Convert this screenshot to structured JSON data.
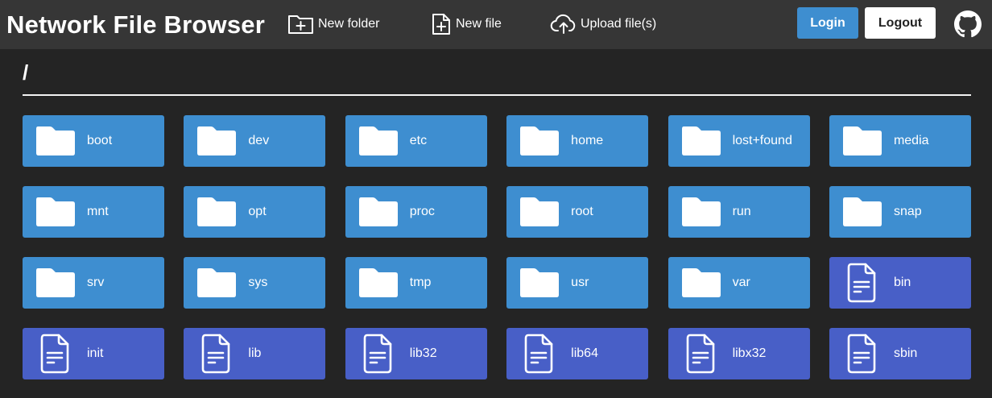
{
  "app": {
    "title": "Network File Browser"
  },
  "toolbar": {
    "new_folder_label": "New folder",
    "new_file_label": "New file",
    "upload_label": "Upload file(s)",
    "login_label": "Login",
    "logout_label": "Logout",
    "github_icon": "github-icon"
  },
  "colors": {
    "navbar": "#363636",
    "background": "#242424",
    "folder_tile": "#3e8ed0",
    "file_tile": "#485fc7",
    "login_button": "#3e8ed0",
    "logout_button": "#ffffff"
  },
  "location": {
    "path": "/"
  },
  "entries": [
    {
      "name": "boot",
      "type": "folder",
      "icon": "folder-icon"
    },
    {
      "name": "dev",
      "type": "folder",
      "icon": "folder-icon"
    },
    {
      "name": "etc",
      "type": "folder",
      "icon": "folder-icon"
    },
    {
      "name": "home",
      "type": "folder",
      "icon": "folder-icon"
    },
    {
      "name": "lost+found",
      "type": "folder",
      "icon": "folder-icon"
    },
    {
      "name": "media",
      "type": "folder",
      "icon": "folder-icon"
    },
    {
      "name": "mnt",
      "type": "folder",
      "icon": "folder-icon"
    },
    {
      "name": "opt",
      "type": "folder",
      "icon": "folder-icon"
    },
    {
      "name": "proc",
      "type": "folder",
      "icon": "folder-icon"
    },
    {
      "name": "root",
      "type": "folder",
      "icon": "folder-icon"
    },
    {
      "name": "run",
      "type": "folder",
      "icon": "folder-icon"
    },
    {
      "name": "snap",
      "type": "folder",
      "icon": "folder-icon"
    },
    {
      "name": "srv",
      "type": "folder",
      "icon": "folder-icon"
    },
    {
      "name": "sys",
      "type": "folder",
      "icon": "folder-icon"
    },
    {
      "name": "tmp",
      "type": "folder",
      "icon": "folder-icon"
    },
    {
      "name": "usr",
      "type": "folder",
      "icon": "folder-icon"
    },
    {
      "name": "var",
      "type": "folder",
      "icon": "folder-icon"
    },
    {
      "name": "bin",
      "type": "file",
      "icon": "file-icon"
    },
    {
      "name": "init",
      "type": "file",
      "icon": "file-icon"
    },
    {
      "name": "lib",
      "type": "file",
      "icon": "file-icon"
    },
    {
      "name": "lib32",
      "type": "file",
      "icon": "file-icon"
    },
    {
      "name": "lib64",
      "type": "file",
      "icon": "file-icon"
    },
    {
      "name": "libx32",
      "type": "file",
      "icon": "file-icon"
    },
    {
      "name": "sbin",
      "type": "file",
      "icon": "file-icon"
    }
  ]
}
